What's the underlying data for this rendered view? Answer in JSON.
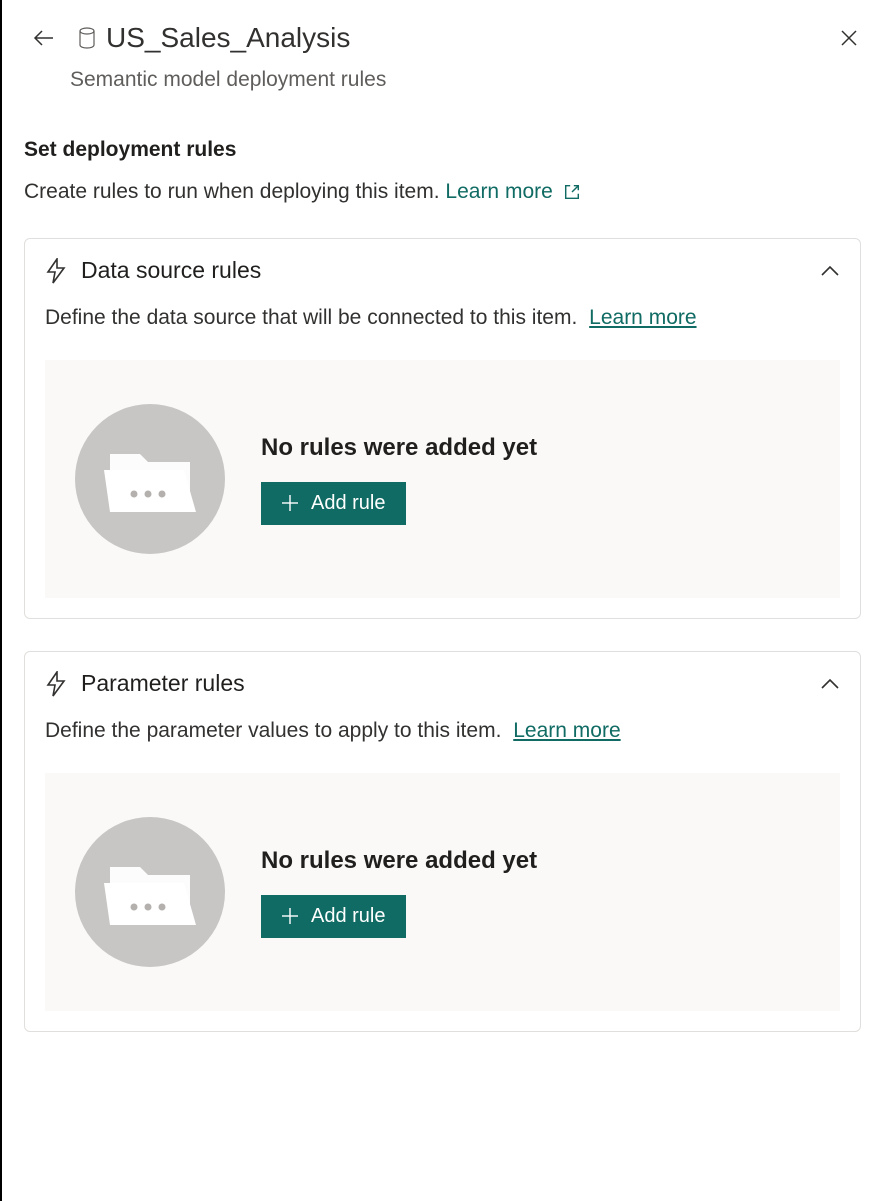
{
  "header": {
    "title": "US_Sales_Analysis",
    "subtitle": "Semantic model deployment rules"
  },
  "intro": {
    "heading": "Set deployment rules",
    "description": "Create rules to run when deploying this item.",
    "learn_more": "Learn more"
  },
  "cards": {
    "dataSource": {
      "title": "Data source rules",
      "description": "Define the data source that will be connected to this item.",
      "learn_more": "Learn more",
      "empty_title": "No rules were added yet",
      "add_rule_label": "Add rule"
    },
    "parameter": {
      "title": "Parameter rules",
      "description": "Define the parameter values to apply to this item.",
      "learn_more": "Learn more",
      "empty_title": "No rules were added yet",
      "add_rule_label": "Add rule"
    }
  },
  "colors": {
    "accent": "#0f6b63",
    "text_primary": "#201f1e",
    "text_secondary": "#605e5c",
    "border": "#e1dfdd",
    "empty_bg": "#faf9f8",
    "circle": "#c8c6c4"
  }
}
